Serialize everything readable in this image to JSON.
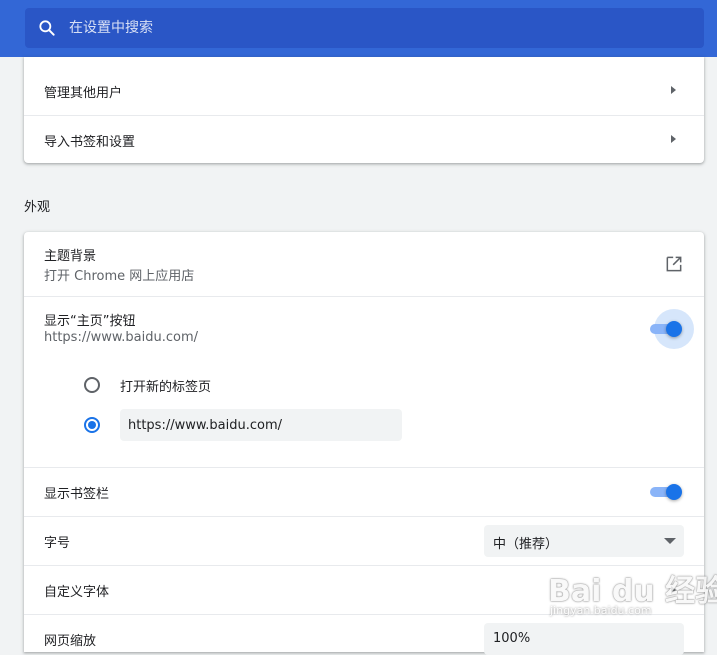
{
  "search": {
    "placeholder": "在设置中搜索"
  },
  "people": {
    "items": [
      {
        "label": "管理其他用户"
      },
      {
        "label": "导入书签和设置"
      }
    ]
  },
  "appearance": {
    "section_title": "外观",
    "theme": {
      "label": "主题背景",
      "sublabel": "打开 Chrome 网上应用店"
    },
    "home_button": {
      "label": "显示“主页”按钮",
      "sublabel": "https://www.baidu.com/",
      "enabled": true,
      "options": [
        {
          "label": "打开新的标签页",
          "selected": false
        },
        {
          "value": "https://www.baidu.com/",
          "selected": true
        }
      ]
    },
    "bookmarks_bar": {
      "label": "显示书签栏",
      "enabled": true
    },
    "font_size": {
      "label": "字号",
      "selected": "中（推荐）"
    },
    "custom_fonts": {
      "label": "自定义字体"
    },
    "page_zoom": {
      "label": "网页缩放",
      "selected": "100%"
    }
  },
  "watermark": {
    "brand": "Bai du 经验",
    "url": "jingyan.baidu.com"
  },
  "colors": {
    "header": "#3367d6",
    "accent": "#1a73e8",
    "background": "#f1f3f4"
  }
}
